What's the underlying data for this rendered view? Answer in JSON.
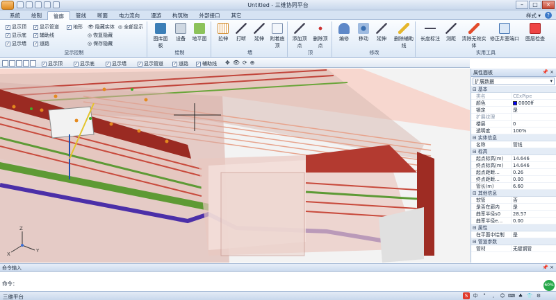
{
  "window": {
    "title": "Untitled - 三维协同平台",
    "controls": [
      "–",
      "□",
      "×"
    ]
  },
  "tabs": [
    "系统",
    "绘制",
    "管廊",
    "管线",
    "断面",
    "电力流向",
    "漫游",
    "构筑物",
    "外部接口",
    "其它"
  ],
  "active_tab": "管廊",
  "style_menu": "样式 ▾",
  "ribbon": {
    "display": {
      "label": "显示控制",
      "checks": [
        "显示顶",
        "显示底",
        "显示墙",
        "显示管道",
        "辅助线",
        "道路",
        "地形"
      ],
      "buttons": [
        "隐藏实体",
        "全部显示",
        "恢复隐藏",
        "保存隐藏"
      ]
    },
    "draw": {
      "label": "绘制",
      "buttons": [
        "图库面板",
        "设备",
        "地平面"
      ]
    },
    "wall": {
      "label": "墙",
      "buttons": [
        "拉伸",
        "打断",
        "延伸",
        "附着底顶"
      ]
    },
    "top": {
      "label": "顶",
      "buttons": [
        "添加顶点",
        "删除顶点"
      ]
    },
    "modify": {
      "label": "修改",
      "buttons": [
        "编修",
        "移动",
        "延伸",
        "删除辅助线"
      ]
    },
    "tools": {
      "label": "实用工具",
      "buttons": [
        "长度标注",
        "测距",
        "清除无效实体",
        "修正井室端口",
        "图层检查"
      ]
    }
  },
  "viewbar": {
    "checks": [
      "显示顶",
      "显示底",
      "显示墙",
      "显示管道",
      "道路",
      "辅助线"
    ]
  },
  "properties": {
    "title": "属性面板",
    "pin": "📌 ×",
    "selector": "扩展数据",
    "rows": [
      {
        "type": "cat",
        "k": "基本"
      },
      {
        "k": "类名",
        "v": "CExPipe",
        "gray": true
      },
      {
        "k": "颜色",
        "v": "0000ff",
        "swatch": "#0000ff"
      },
      {
        "k": "锁定",
        "v": "是"
      },
      {
        "k": "扩展纹理",
        "v": "",
        "gray": true
      },
      {
        "k": "楼层",
        "v": "0"
      },
      {
        "k": "透明度",
        "v": "100%"
      },
      {
        "type": "cat",
        "k": "实体信息"
      },
      {
        "k": "名称",
        "v": "管线"
      },
      {
        "type": "cat",
        "k": "标高"
      },
      {
        "k": "起点标高(m)",
        "v": "14.646"
      },
      {
        "k": "终点标高(m)",
        "v": "14.646"
      },
      {
        "k": "起点距断…",
        "v": "0.26"
      },
      {
        "k": "终点距断…",
        "v": "0.00"
      },
      {
        "k": "管长(m)",
        "v": "6.60"
      },
      {
        "type": "cat",
        "k": "其他信息"
      },
      {
        "k": "软管",
        "v": "否"
      },
      {
        "k": "是否在廊内",
        "v": "是"
      },
      {
        "k": "曲率半径s0",
        "v": "28.57"
      },
      {
        "k": "曲率半径e…",
        "v": "0.00"
      },
      {
        "type": "cat",
        "k": "属性"
      },
      {
        "k": "在平面中绘制",
        "v": "是"
      },
      {
        "type": "cat",
        "k": "管道参数"
      },
      {
        "k": "管材",
        "v": "无缝钢管"
      }
    ]
  },
  "command": {
    "title": "命令输入",
    "pin": "📌 ×",
    "prompt": "命令："
  },
  "status": {
    "text": "三维平台",
    "tray": [
      "S",
      "中",
      "°",
      ",",
      "☺",
      "⌨",
      "♣",
      "👕",
      "⚙"
    ],
    "ball": "60%"
  }
}
